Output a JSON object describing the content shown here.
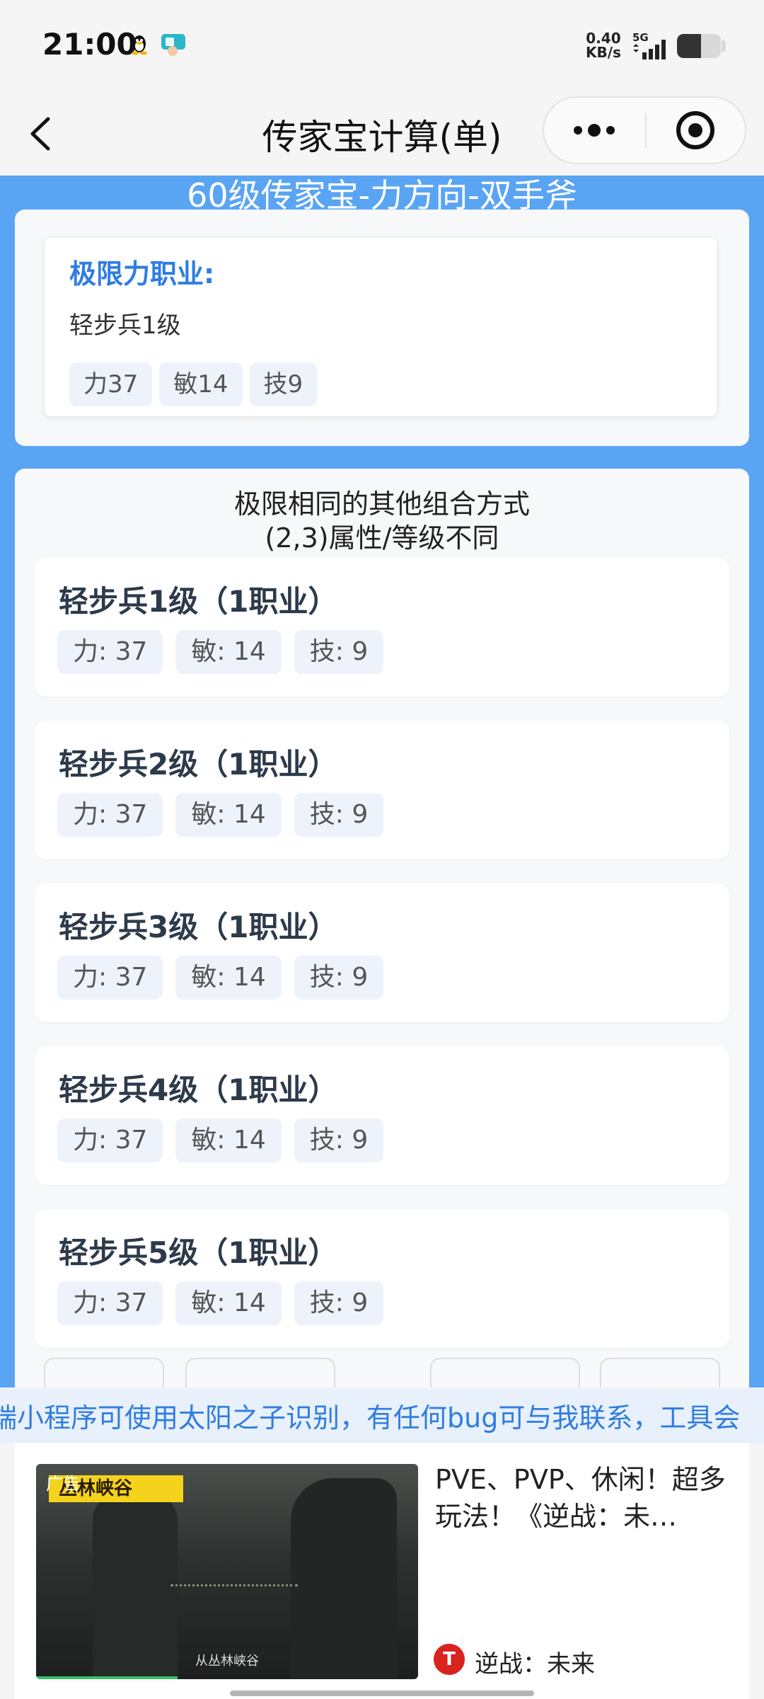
{
  "status_bar": {
    "time": "21:00",
    "net_speed_value": "0.40",
    "net_speed_unit": "KB/s",
    "network_type": "5G",
    "battery_level": 0.55
  },
  "nav": {
    "title": "传家宝计算(单)"
  },
  "main": {
    "header": "60级传家宝-力方向-双手斧",
    "limit": {
      "title": "极限力职业:",
      "job": "轻步兵1级",
      "chips": [
        "力37",
        "敏14",
        "技9"
      ]
    },
    "combos": {
      "title_line1": "极限相同的其他组合方式",
      "title_line2": "(2,3)属性/等级不同",
      "items": [
        {
          "name": "轻步兵1级（1职业）",
          "str": "力: 37",
          "dex": "敏: 14",
          "skl": "技: 9"
        },
        {
          "name": "轻步兵2级（1职业）",
          "str": "力: 37",
          "dex": "敏: 14",
          "skl": "技: 9"
        },
        {
          "name": "轻步兵3级（1职业）",
          "str": "力: 37",
          "dex": "敏: 14",
          "skl": "技: 9"
        },
        {
          "name": "轻步兵4级（1职业）",
          "str": "力: 37",
          "dex": "敏: 14",
          "skl": "技: 9"
        },
        {
          "name": "轻步兵5级（1职业）",
          "str": "力: 37",
          "dex": "敏: 14",
          "skl": "技: 9"
        }
      ]
    }
  },
  "marquee": {
    "text": "端小程序可使用太阳之子识别，有任何bug可与我联系，工具会"
  },
  "ad": {
    "label": "广告",
    "banner": "丛林峡谷",
    "caption": "从丛林峡谷",
    "description": "PVE、PVP、休闲！超多玩法！《逆战：未…",
    "logo_text": "T",
    "brand": "逆战：未来",
    "video_progress": 0.37
  },
  "colors": {
    "accent_blue": "#5aa4f4",
    "title_blue": "#2f7de1",
    "chip_bg": "#eef3fb"
  }
}
